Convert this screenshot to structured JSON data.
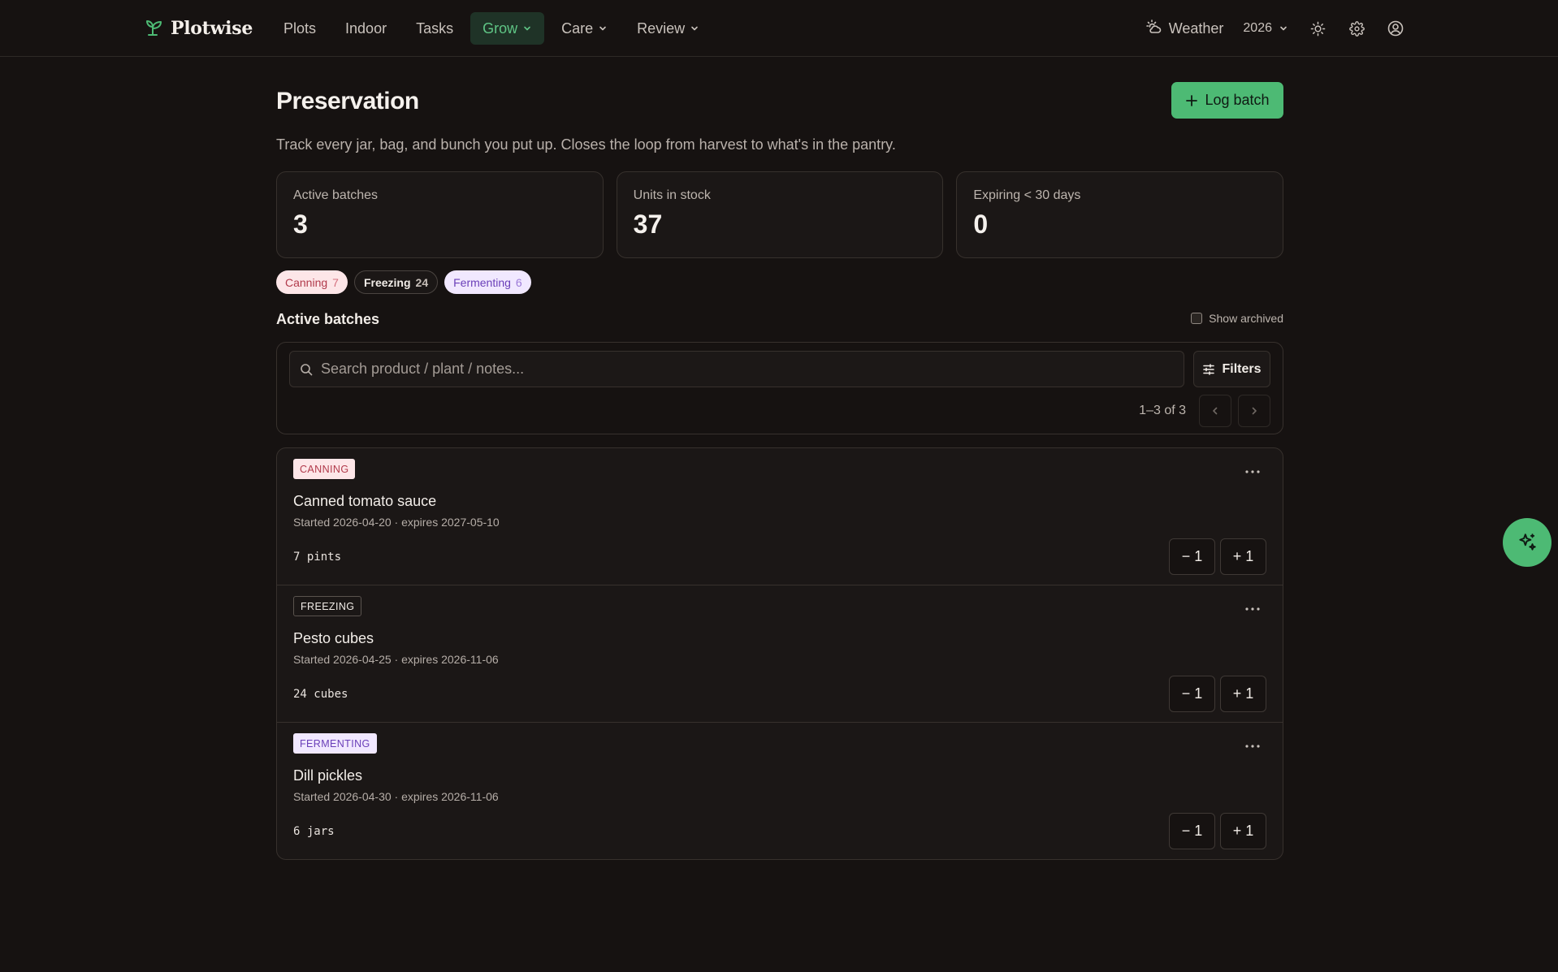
{
  "app": {
    "brand": "Plotwise",
    "nav": [
      {
        "label": "Plots"
      },
      {
        "label": "Indoor"
      },
      {
        "label": "Tasks"
      },
      {
        "label": "Grow"
      },
      {
        "label": "Care"
      },
      {
        "label": "Review"
      }
    ],
    "active_nav": "Grow",
    "weather_label": "Weather",
    "year_label": "2026",
    "icons": [
      "sprout-icon",
      "cloud-sun-icon",
      "sun-icon",
      "gear-icon",
      "user-circle-icon",
      "sparkles-icon"
    ]
  },
  "page": {
    "title": "Preservation",
    "subtitle": "Track every jar, bag, and bunch you put up. Closes the loop from harvest to what's in the pantry.",
    "log_button": "Log batch"
  },
  "stats": [
    {
      "label": "Active batches",
      "value": "3"
    },
    {
      "label": "Units in stock",
      "value": "37"
    },
    {
      "label": "Expiring < 30 days",
      "value": "0"
    }
  ],
  "chips": [
    {
      "label": "Canning",
      "count": "7"
    },
    {
      "label": "Freezing",
      "count": "24"
    },
    {
      "label": "Fermenting",
      "count": "6"
    }
  ],
  "section": {
    "title": "Active batches",
    "show_archived": "Show archived",
    "show_archived_checked": false
  },
  "search": {
    "placeholder": "Search product / plant / notes...",
    "value": ""
  },
  "filters_label": "Filters",
  "pager": {
    "text": "1–3 of 3"
  },
  "batches": [
    {
      "tag": "CANNING",
      "title": "Canned tomato sauce",
      "meta": "Started 2026-04-20 · expires 2027-05-10",
      "qty": "7 pints",
      "dec": "− 1",
      "inc": "+ 1"
    },
    {
      "tag": "FREEZING",
      "title": "Pesto cubes",
      "meta": "Started 2026-04-25 · expires 2026-11-06",
      "qty": "24 cubes",
      "dec": "− 1",
      "inc": "+ 1"
    },
    {
      "tag": "FERMENTING",
      "title": "Dill pickles",
      "meta": "Started 2026-04-30 · expires 2026-11-06",
      "qty": "6 jars",
      "dec": "− 1",
      "inc": "+ 1"
    }
  ],
  "colors": {
    "accent": "#4dba74",
    "background": "#161211",
    "canning": "#fde6e8",
    "fermenting": "#f1e8ff"
  }
}
